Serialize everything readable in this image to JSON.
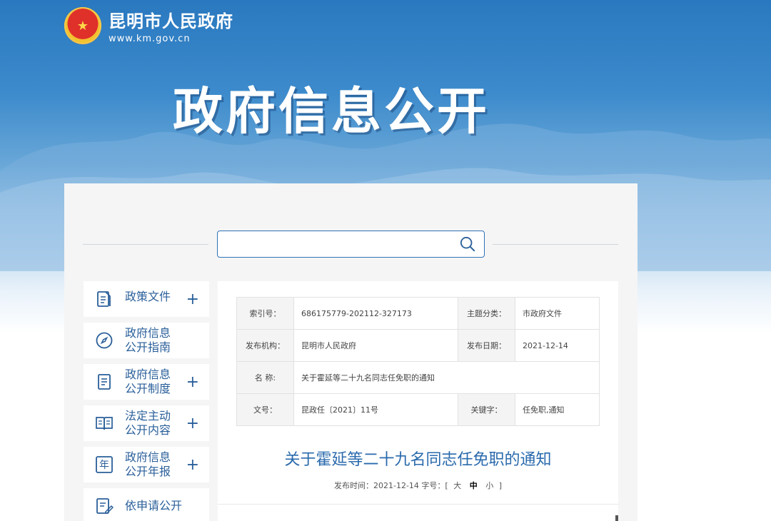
{
  "header": {
    "site_name": "昆明市人民政府",
    "site_url": "www.km.gov.cn",
    "hero_title": "政府信息公开"
  },
  "search": {
    "placeholder": "",
    "value": ""
  },
  "sidebar": {
    "items": [
      {
        "label": "政策文件",
        "icon": "document-icon",
        "expandable": true
      },
      {
        "label": "政府信息\n公开指南",
        "icon": "compass-icon",
        "expandable": false
      },
      {
        "label": "政府信息\n公开制度",
        "icon": "clipboard-icon",
        "expandable": true
      },
      {
        "label": "法定主动\n公开内容",
        "icon": "open-book-icon",
        "expandable": true
      },
      {
        "label": "政府信息\n公开年报",
        "icon": "calendar-year-icon",
        "expandable": true
      },
      {
        "label": "依申请公开",
        "icon": "edit-form-icon",
        "expandable": false
      }
    ],
    "plus_glyph": "+",
    "year_glyph": "年"
  },
  "meta_table": {
    "index_no_label": "索引号：",
    "index_no": "686175779-202112-327173",
    "topic_label": "主题分类：",
    "topic": "市政府文件",
    "publisher_label": "发布机构：",
    "publisher": "昆明市人民政府",
    "pub_date_label": "发布日期：",
    "pub_date": "2021-12-14",
    "name_label": "名 称:",
    "name": "关于霍延等二十九名同志任免职的通知",
    "doc_no_label": "文号：",
    "doc_no": "昆政任〔2021〕11号",
    "keywords_label": "关键字：",
    "keywords": "任免职,通知"
  },
  "document": {
    "title": "关于霍延等二十九名同志任免职的通知",
    "publish_time_text": "发布时间：2021-12-14 字号：[",
    "size_large": "大",
    "size_medium": "中",
    "size_small": "小",
    "bracket_close": "]"
  },
  "colors": {
    "accent": "#2a6aad",
    "sky_top": "#2a78bf",
    "panel_bg": "#f5f5f5"
  }
}
